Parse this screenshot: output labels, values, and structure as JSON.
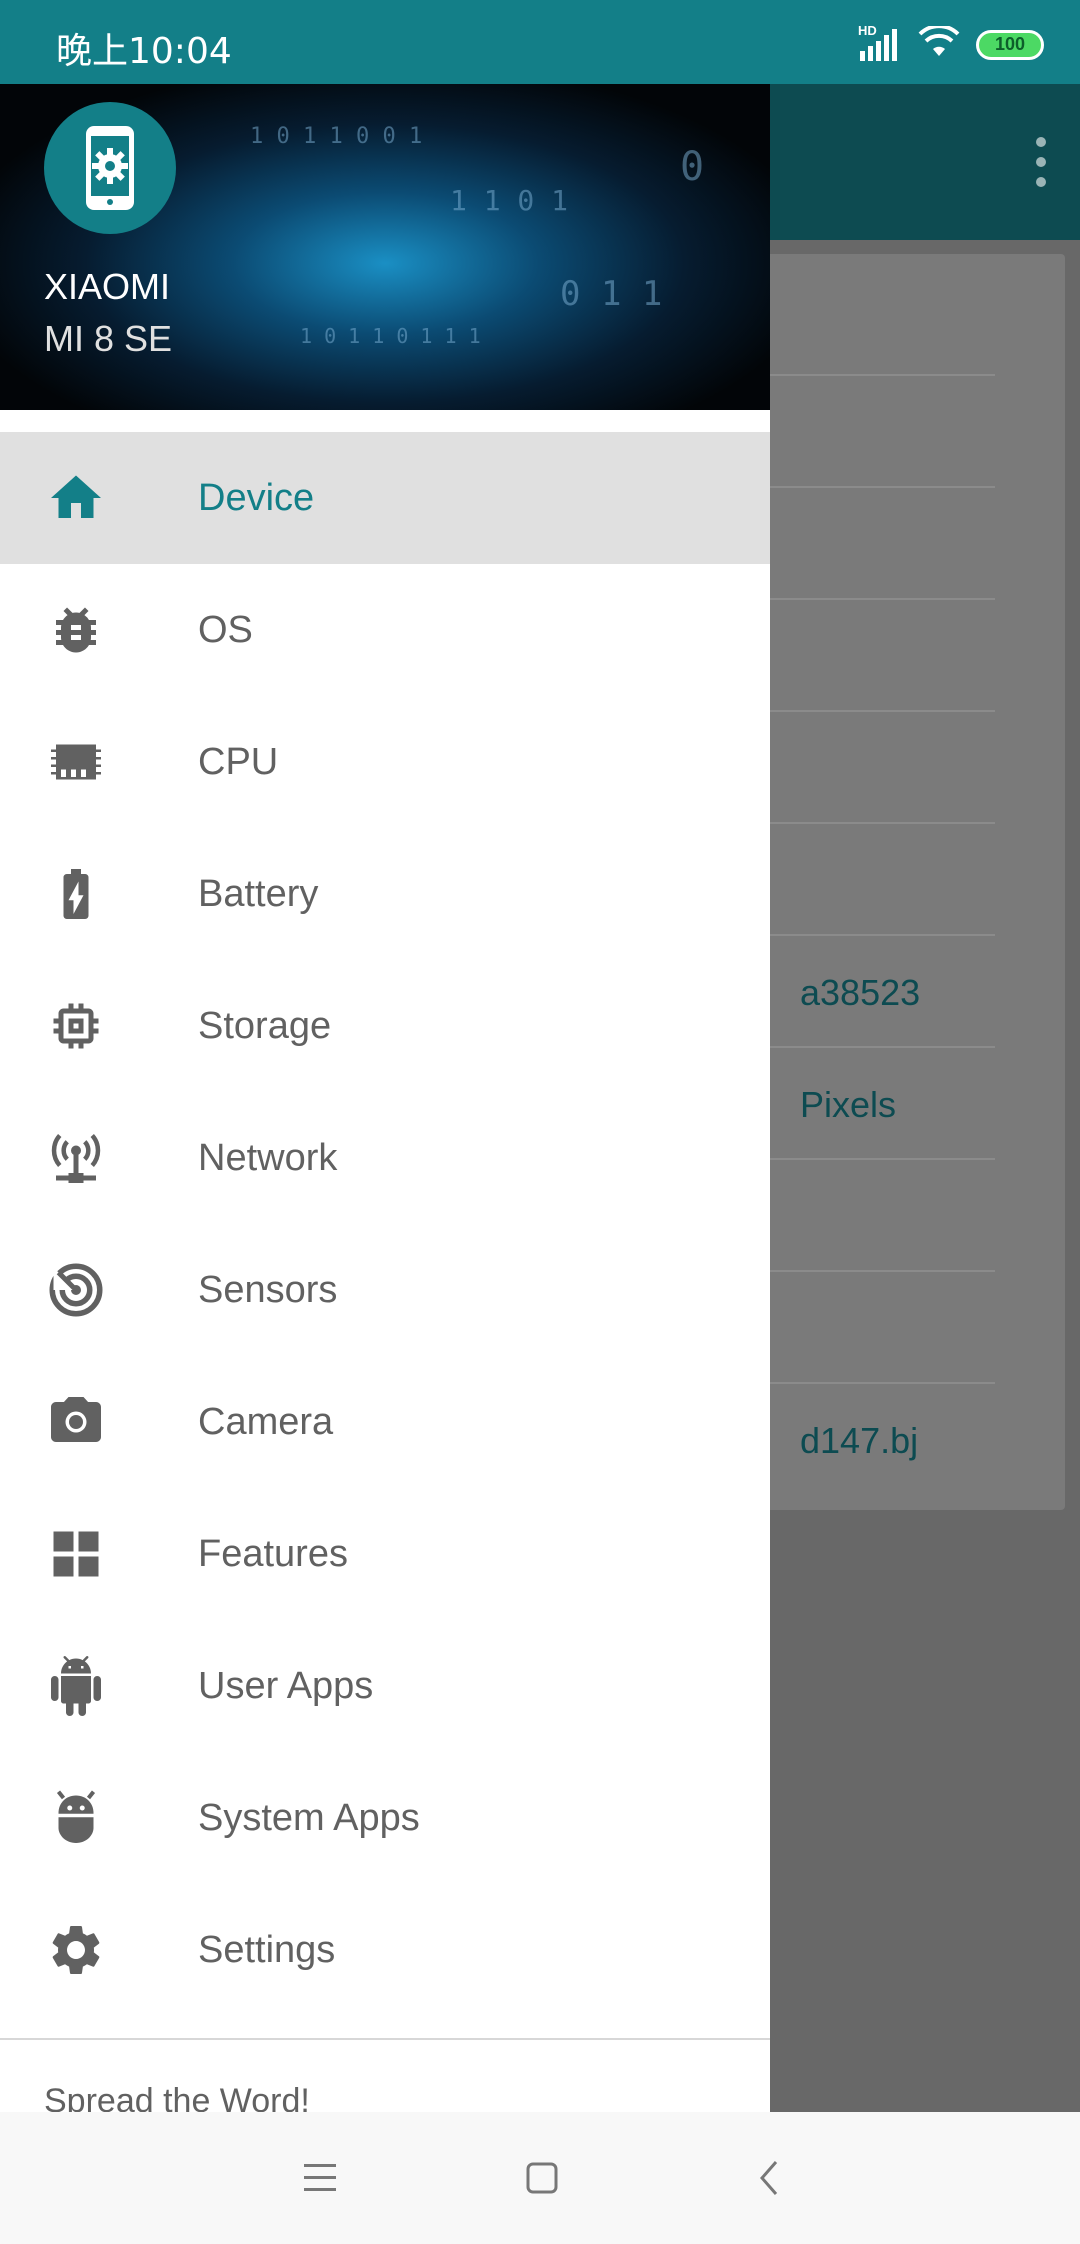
{
  "status_bar": {
    "time": "晚上10:04",
    "network_label": "HD",
    "battery_level": "100"
  },
  "drawer": {
    "header": {
      "brand": "XIAOMI",
      "model": "MI 8 SE"
    },
    "items": [
      {
        "label": "Device",
        "icon": "home-icon",
        "selected": true
      },
      {
        "label": "OS",
        "icon": "bug-icon",
        "selected": false
      },
      {
        "label": "CPU",
        "icon": "memory-icon",
        "selected": false
      },
      {
        "label": "Battery",
        "icon": "battery-charging-icon",
        "selected": false
      },
      {
        "label": "Storage",
        "icon": "chip-icon",
        "selected": false
      },
      {
        "label": "Network",
        "icon": "antenna-icon",
        "selected": false
      },
      {
        "label": "Sensors",
        "icon": "radar-icon",
        "selected": false
      },
      {
        "label": "Camera",
        "icon": "camera-icon",
        "selected": false
      },
      {
        "label": "Features",
        "icon": "dashboard-icon",
        "selected": false
      },
      {
        "label": "User Apps",
        "icon": "android-icon",
        "selected": false
      },
      {
        "label": "System Apps",
        "icon": "android-head-icon",
        "selected": false
      },
      {
        "label": "Settings",
        "icon": "gear-icon",
        "selected": false
      }
    ],
    "section_title": "Spread the Word!"
  },
  "background": {
    "visible_values": [
      "a38523",
      "Pixels",
      "d147.bj"
    ]
  },
  "colors": {
    "accent": "#137f88",
    "selected_bg": "#e0e0e0",
    "icon_gray": "#616161",
    "toolbar_dark": "#0d4b51"
  },
  "nav_bar": {
    "icons": [
      "menu-icon",
      "home-square-icon",
      "back-icon"
    ]
  }
}
